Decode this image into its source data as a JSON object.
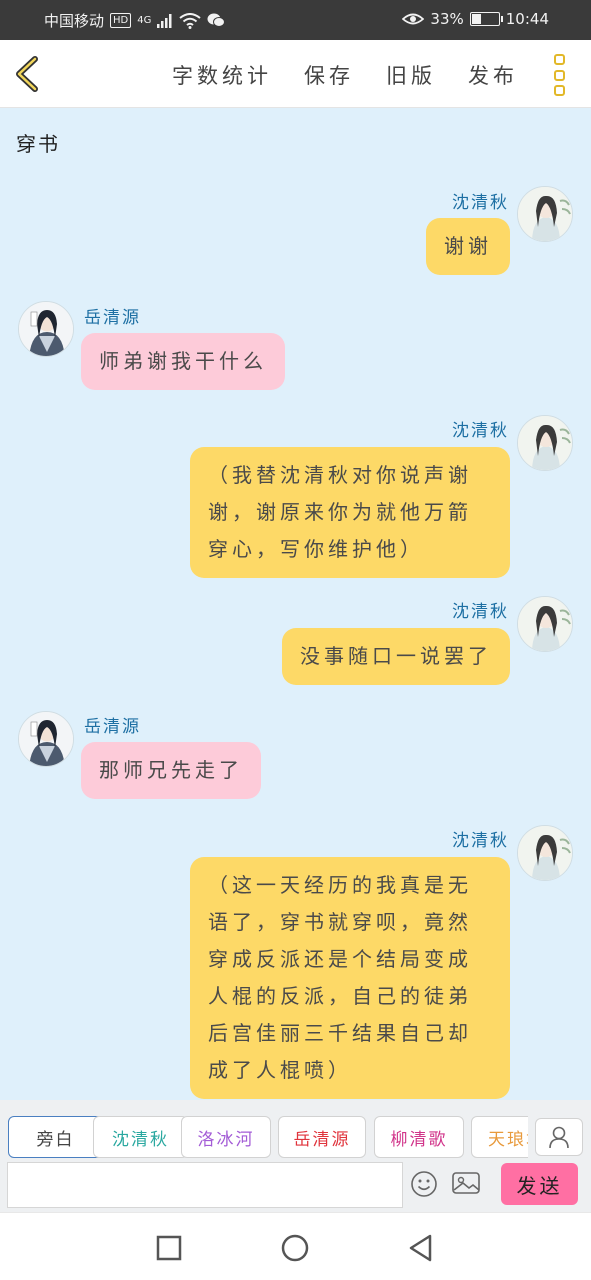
{
  "status": {
    "carrier": "中国移动",
    "hd": "HD",
    "network": "4G",
    "battery": "33%",
    "battery_level": 0.33,
    "time": "10:44"
  },
  "toolbar": {
    "word_count": "字数统计",
    "save": "保存",
    "old_version": "旧版",
    "publish": "发布"
  },
  "story": {
    "title": "穿书"
  },
  "messages": [
    {
      "name": "沈清秋",
      "text": "谢谢"
    },
    {
      "name": "岳清源",
      "text": "师弟谢我干什么"
    },
    {
      "name": "沈清秋",
      "lines": [
        "（我替沈清秋对你说声谢",
        "谢，谢原来你为就他万箭",
        "穿心，写你维护他）"
      ]
    },
    {
      "name": "沈清秋",
      "text": "没事随口一说罢了"
    },
    {
      "name": "岳清源",
      "text": "那师兄先走了"
    },
    {
      "name": "沈清秋",
      "lines": [
        "（这一天经历的我真是无",
        "语了，穿书就穿呗，竟然",
        "穿成反派还是个结局变成",
        "人棍的反派，自己的徒弟",
        "后宫佳丽三千结果自己却",
        "成了人棍喷）"
      ]
    }
  ],
  "characters": [
    {
      "label": "旁白",
      "color": "#444444"
    },
    {
      "label": "沈清秋",
      "color": "#2aa8a0"
    },
    {
      "label": "洛冰河",
      "color": "#a35cd6"
    },
    {
      "label": "岳清源",
      "color": "#e0343c"
    },
    {
      "label": "柳清歌",
      "color": "#d1348a"
    },
    {
      "label": "天琅君",
      "color": "#e89a3c"
    }
  ],
  "compose": {
    "input_value": "",
    "send": "发送"
  }
}
